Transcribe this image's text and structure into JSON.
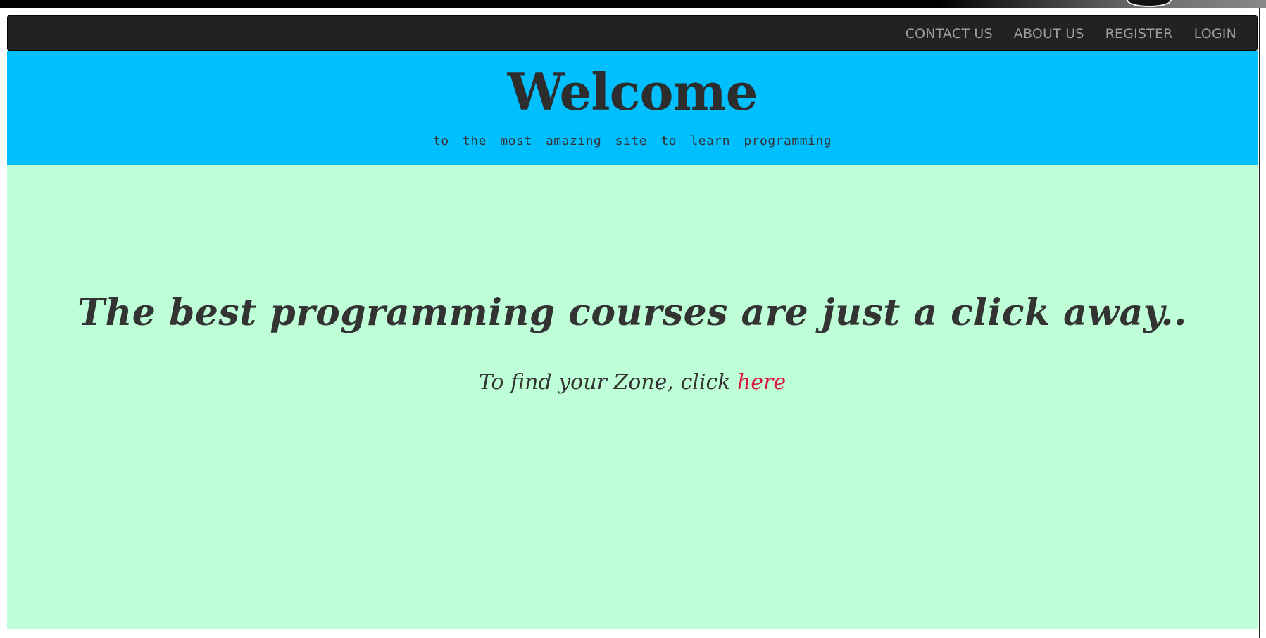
{
  "navbar": {
    "items": [
      {
        "label": "CONTACT US"
      },
      {
        "label": "ABOUT US"
      },
      {
        "label": "REGISTER"
      },
      {
        "label": "LOGIN"
      }
    ]
  },
  "header": {
    "title": "Welcome",
    "tagline": "to the most amazing site to learn programming"
  },
  "main": {
    "lead": "The best programming courses are just a click away..",
    "sub_prefix": "To find your Zone, click",
    "link_label": "here"
  },
  "colors": {
    "navbar_bg": "#222222",
    "nav_link": "#9d9d9d",
    "header_bg": "#00bfff",
    "main_bg": "#bfffd7",
    "text": "#333333",
    "link": "#dc143c"
  }
}
